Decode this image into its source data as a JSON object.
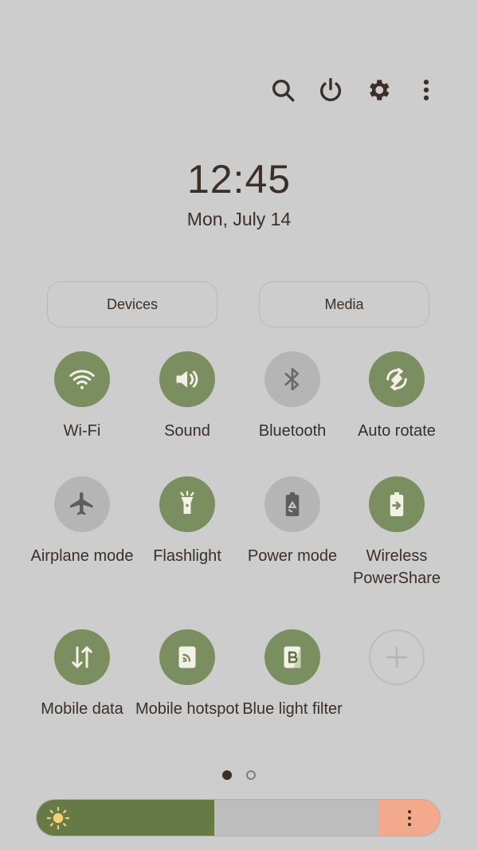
{
  "clock": {
    "time": "12:45",
    "date": "Mon, July 14"
  },
  "top_icons": [
    "search-icon",
    "power-icon",
    "gear-icon",
    "more-vertical-icon"
  ],
  "buttons": {
    "devices": "Devices",
    "media": "Media"
  },
  "tiles": [
    {
      "label": "Wi-Fi",
      "icon": "wifi-icon",
      "state": "on"
    },
    {
      "label": "Sound",
      "icon": "speaker-icon",
      "state": "on"
    },
    {
      "label": "Bluetooth",
      "icon": "bluetooth-icon",
      "state": "off"
    },
    {
      "label": "Auto rotate",
      "icon": "auto-rotate-icon",
      "state": "on"
    },
    {
      "label": "Airplane mode",
      "icon": "airplane-icon",
      "state": "off"
    },
    {
      "label": "Flashlight",
      "icon": "flashlight-icon",
      "state": "on"
    },
    {
      "label": "Power mode",
      "icon": "power-mode-battery-icon",
      "state": "off"
    },
    {
      "label": "Wireless PowerShare",
      "icon": "wireless-powershare-icon",
      "state": "on"
    },
    {
      "label": "Mobile data",
      "icon": "mobile-data-arrows-icon",
      "state": "on"
    },
    {
      "label": "Mobile hotspot",
      "icon": "hotspot-icon",
      "state": "on"
    },
    {
      "label": "Blue light filter",
      "icon": "blue-light-filter-icon",
      "state": "on"
    },
    {
      "label": "",
      "icon": "add-plus-icon",
      "state": "empty"
    }
  ],
  "page_indicator": {
    "pages": 2,
    "current": 1
  },
  "brightness": {
    "level_fraction": 0.44
  },
  "colors": {
    "tile_on": "#7a8e60",
    "tile_off": "#b5b5b5",
    "background": "#cdcdcd",
    "brightness_fill": "#667a46",
    "brightness_more": "#f3a98c"
  }
}
